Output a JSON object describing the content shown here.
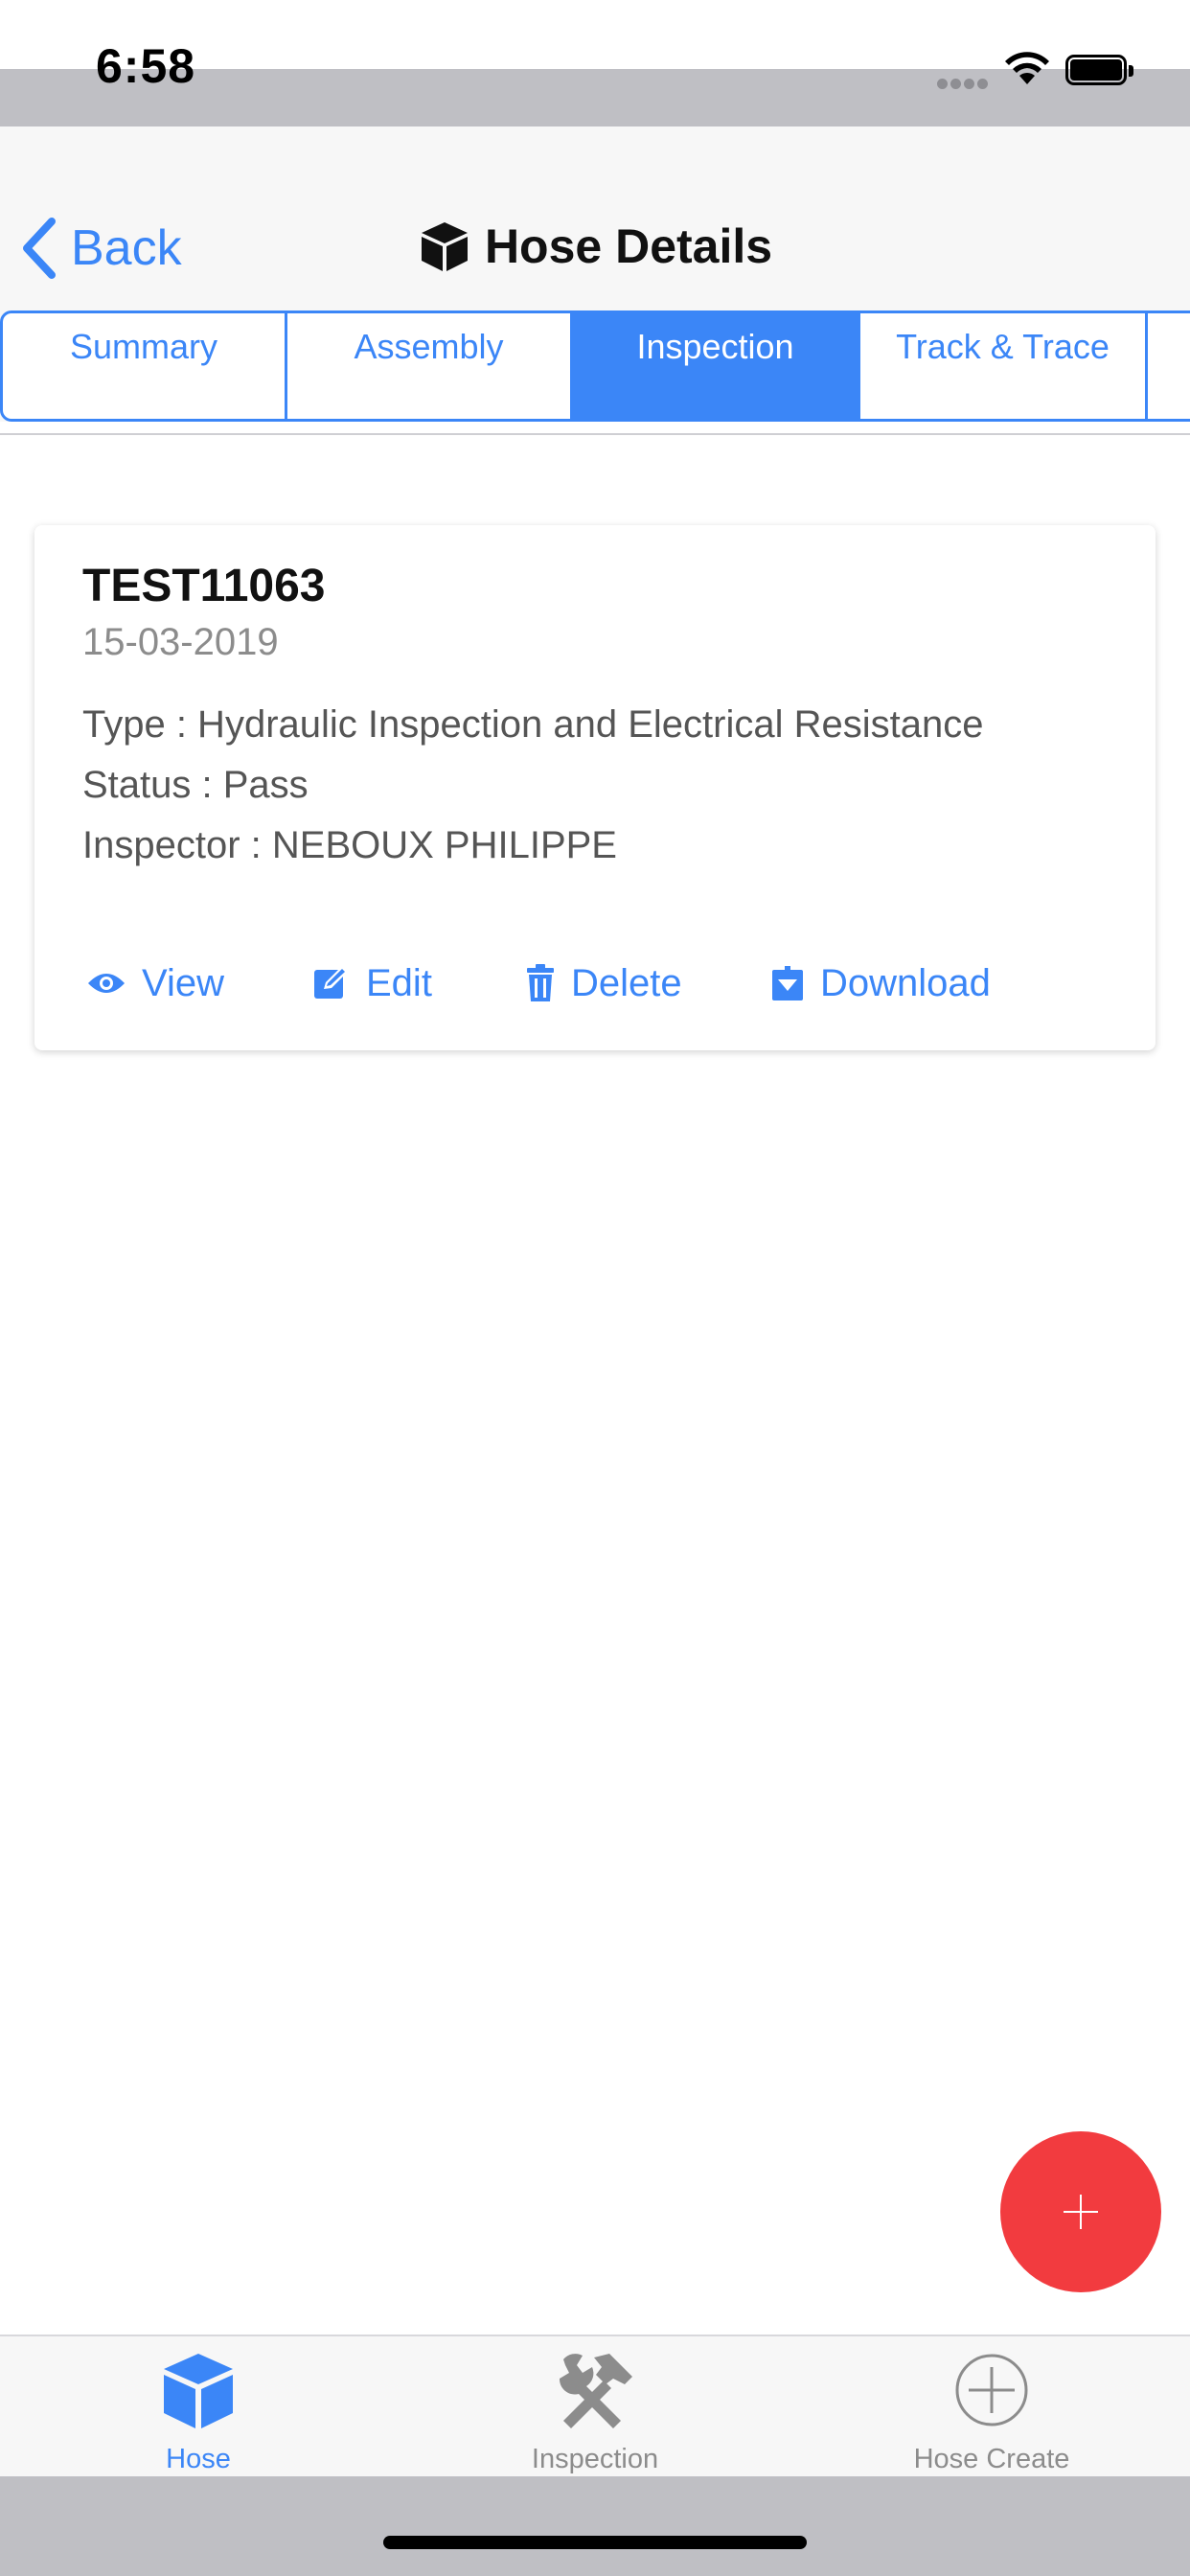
{
  "status_bar": {
    "time": "6:58"
  },
  "nav": {
    "back_label": "Back",
    "title": "Hose Details",
    "title_icon": "cube-icon"
  },
  "tabs": [
    {
      "label": "Summary",
      "active": false
    },
    {
      "label": "Assembly",
      "active": false
    },
    {
      "label": "Inspection",
      "active": true
    },
    {
      "label": "Track & Trace",
      "active": false
    }
  ],
  "inspection_card": {
    "id": "TEST11063",
    "date": "15-03-2019",
    "type_line": "Type : Hydraulic Inspection and Electrical Resistance",
    "status_line": "Status : Pass",
    "inspector_line": "Inspector : NEBOUX PHILIPPE",
    "actions": {
      "view": "View",
      "edit": "Edit",
      "delete": "Delete",
      "download": "Download"
    }
  },
  "fab": {
    "label": "+",
    "icon": "plus-icon"
  },
  "tabbar": [
    {
      "label": "Hose",
      "icon": "cube-icon",
      "active": true
    },
    {
      "label": "Inspection",
      "icon": "tools-icon",
      "active": false
    },
    {
      "label": "Hose Create",
      "icon": "plus-circle-icon",
      "active": false
    }
  ],
  "colors": {
    "accent": "#3b86f7",
    "fab": "#f23b3f",
    "inactive": "#8c8c8c"
  }
}
